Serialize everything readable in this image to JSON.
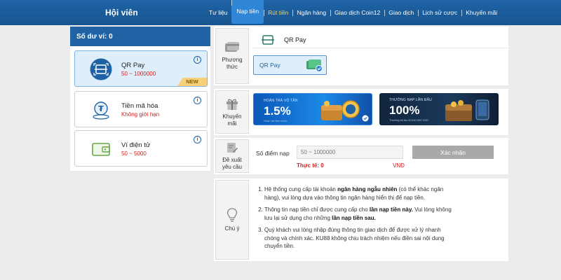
{
  "header": {
    "title": "Hội viên",
    "nav": [
      "Tư liệu",
      "Nạp tiền",
      "Rút tiền",
      "Ngân hàng",
      "Giao dịch Coin12",
      "Giao dịch",
      "Lịch sử cược",
      "Khuyến mãi"
    ],
    "active_index": 1,
    "highlight_index": 2
  },
  "wallet": {
    "balance_label": "Số dư ví: 0",
    "cards": [
      {
        "name": "QR Pay",
        "range": "50 ~ 1000000",
        "badge": "NEW",
        "selected": true
      },
      {
        "name": "Tiền mã hóa",
        "range": "Không giới hạn",
        "selected": false
      },
      {
        "name": "Ví điện tử",
        "range": "50 ~ 5000",
        "selected": false
      }
    ]
  },
  "method": {
    "side_label_1": "Phương",
    "side_label_2": "thức",
    "title": "QR Pay",
    "option": "QR Pay"
  },
  "promotion": {
    "side_label_1": "Khuyến",
    "side_label_2": "mãi",
    "promos": [
      {
        "tag": "HOÀN TRẢ VÔ TẬN",
        "value": "1.5%",
        "sub": "Hoàn trả tiền cược"
      },
      {
        "tag": "THƯỞNG NẠP LẦN ĐẦU",
        "value": "100%",
        "sub": "Thưởng tối đa 20,000,000 VND"
      }
    ]
  },
  "deposit": {
    "side_label_1": "Đề xuất",
    "side_label_2": "yêu cầu",
    "field_label": "Số điểm nạp",
    "placeholder": "50 ~ 1000000",
    "actual": "Thực tế: 0",
    "currency": "VNĐ",
    "confirm": "Xác nhận"
  },
  "notes": {
    "side_label": "Chú ý",
    "items": [
      {
        "a": "Hệ thống cung cấp tài khoản ",
        "b": "ngân hàng ngẫu nhiên",
        "c": " (có thể khác ngân hàng), vui lòng dựa vào thông tin ngân hàng hiển thị để nạp tiền."
      },
      {
        "a": "Thông tin nạp tiền chỉ được cung cấp cho ",
        "b": "lần nạp tiền này.",
        "c": " Vui lòng không lưu lại sử dụng cho những ",
        "d": "lần nạp tiền sau."
      },
      {
        "a": "Quý khách vui lòng nhập đúng thông tin giao dịch để được xử lý nhanh chóng và chính xác. KU88 không chịu trách nhiệm nếu điền sai nội dung chuyển tiền."
      }
    ]
  },
  "colors": {
    "primary": "#1f63a5",
    "accent_red": "#d32020",
    "highlight_yellow": "#f2d36b"
  }
}
